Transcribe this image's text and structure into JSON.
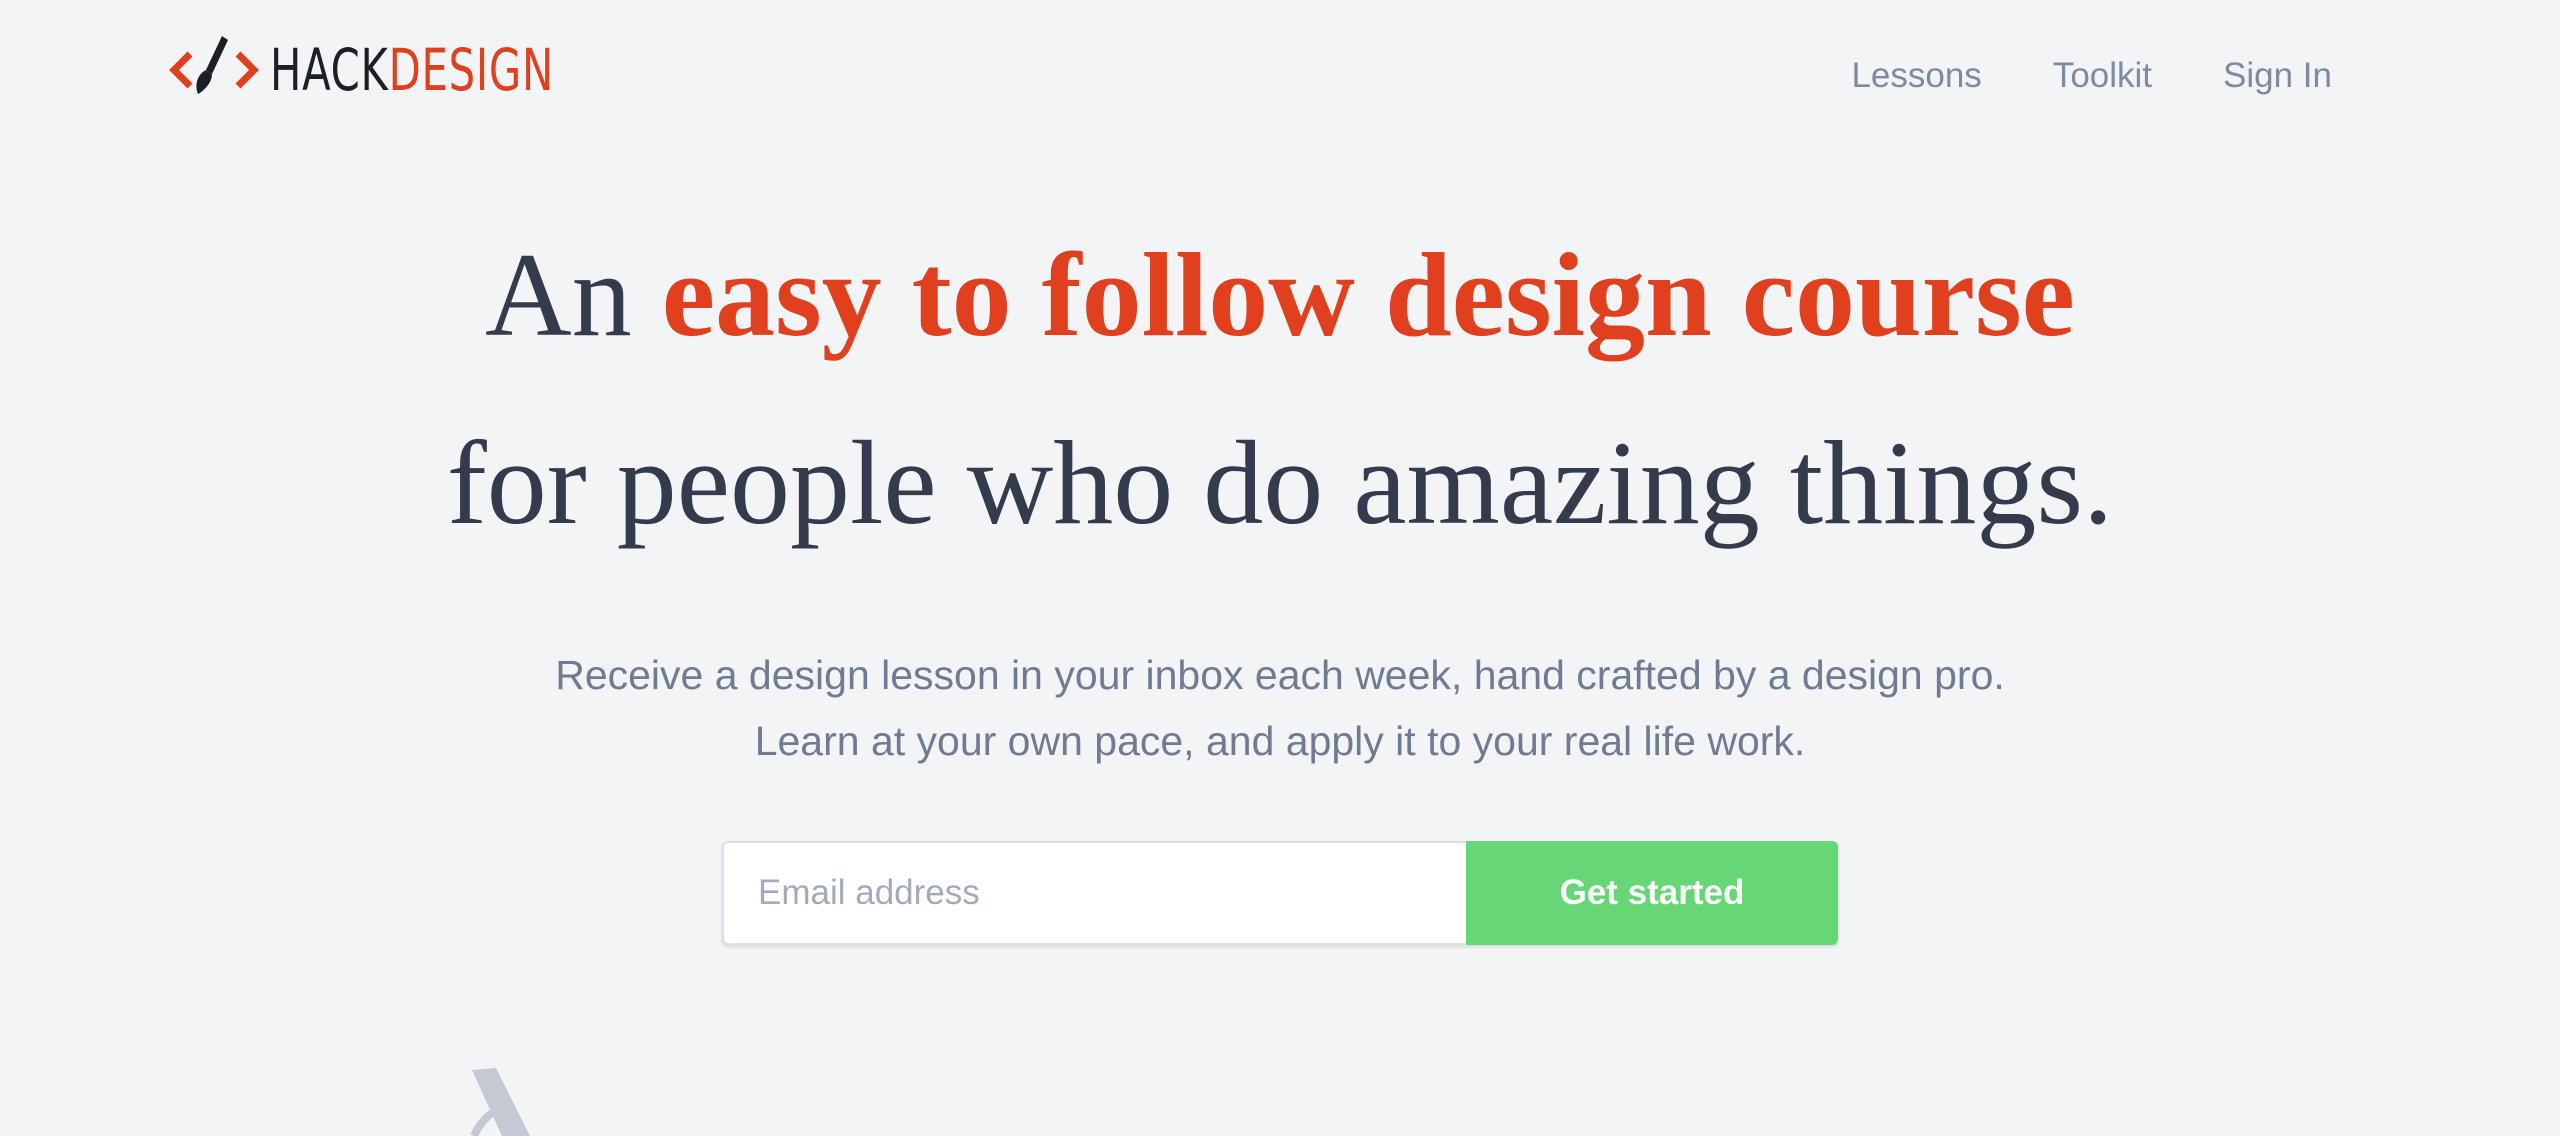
{
  "header": {
    "logo": {
      "hack": "HACK",
      "design": "DESIGN"
    },
    "nav": [
      {
        "label": "Lessons"
      },
      {
        "label": "Toolkit"
      },
      {
        "label": "Sign In"
      }
    ]
  },
  "hero": {
    "line1_prefix": "An ",
    "line1_accent": "easy to follow design course",
    "line2": "for people who do amazing things."
  },
  "subtitle": {
    "line1": "Receive a design lesson in your inbox each week, hand crafted by a design pro.",
    "line2": "Learn at your own pace, and apply it to your real life work."
  },
  "signup": {
    "email_placeholder": "Email address",
    "email_value": "",
    "button_label": "Get started"
  },
  "colors": {
    "background": "#f3f4f6",
    "accent": "#e0401e",
    "heading": "#343b4d",
    "nav": "#7d8aa3",
    "cta": "#66d677"
  },
  "icons": {
    "logo_mark": "code-brackets-paintbrush-icon",
    "bottom_illustration": "pencil-illustration"
  }
}
